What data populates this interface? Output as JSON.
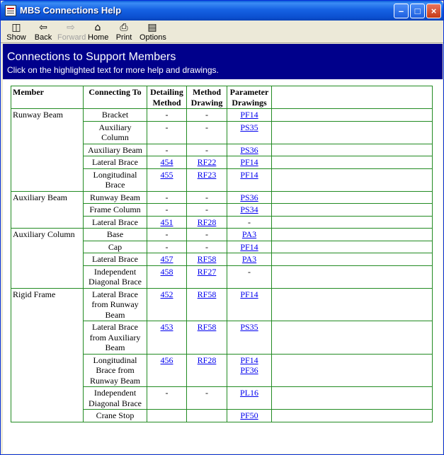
{
  "window": {
    "title": "MBS Connections Help"
  },
  "toolbar": {
    "show": "Show",
    "back": "Back",
    "forward": "Forward",
    "home": "Home",
    "print": "Print",
    "options": "Options"
  },
  "banner": {
    "title": "Connections to Support Members",
    "subtitle": "Click on the highlighted text for more help and drawings."
  },
  "table": {
    "headers": {
      "member": "Member",
      "connecting_to": "Connecting To",
      "detailing_method": "Detailing Method",
      "method_drawing": "Method Drawing",
      "parameter_drawings": "Parameter Drawings"
    },
    "groups": [
      {
        "member": "Runway Beam",
        "rows": [
          {
            "to": "Bracket",
            "detail": "-",
            "method": "-",
            "params": [
              "PF14"
            ]
          },
          {
            "to": "Auxiliary Column",
            "detail": "-",
            "method": "-",
            "params": [
              "PS35"
            ]
          },
          {
            "to": "Auxiliary Beam",
            "detail": "-",
            "method": "-",
            "params": [
              "PS36"
            ]
          },
          {
            "to": "Lateral Brace",
            "detail": "454",
            "method": "RF22",
            "params": [
              "PF14"
            ]
          },
          {
            "to": "Longitudinal Brace",
            "detail": "455",
            "method": "RF23",
            "params": [
              "PF14"
            ]
          }
        ]
      },
      {
        "member": "Auxiliary Beam",
        "rows": [
          {
            "to": "Runway Beam",
            "detail": "-",
            "method": "-",
            "params": [
              "PS36"
            ]
          },
          {
            "to": "Frame Column",
            "detail": "-",
            "method": "-",
            "params": [
              "PS34"
            ]
          },
          {
            "to": "Lateral Brace",
            "detail": "451",
            "method": "RF28",
            "params": [
              "-"
            ]
          }
        ]
      },
      {
        "member": "Auxiliary Column",
        "rows": [
          {
            "to": "Base",
            "detail": "-",
            "method": "-",
            "params": [
              "PA3"
            ]
          },
          {
            "to": "Cap",
            "detail": "-",
            "method": "-",
            "params": [
              "PF14"
            ]
          },
          {
            "to": "Lateral Brace",
            "detail": "457",
            "method": "RF58",
            "params": [
              "PA3"
            ]
          },
          {
            "to": "Independent Diagonal Brace",
            "detail": "458",
            "method": "RF27",
            "params": [
              "-"
            ]
          }
        ]
      },
      {
        "member": "Rigid Frame",
        "rows": [
          {
            "to": "Lateral Brace from Runway Beam",
            "detail": "452",
            "method": "RF58",
            "params": [
              "PF14"
            ]
          },
          {
            "to": "Lateral Brace from Auxiliary Beam",
            "detail": "453",
            "method": "RF58",
            "params": [
              "PS35"
            ]
          },
          {
            "to": "Longitudinal Brace from Runway Beam",
            "detail": "456",
            "method": "RF28",
            "params": [
              "PF14",
              "PF36"
            ]
          },
          {
            "to": "Independent Diagonal Brace",
            "detail": "-",
            "method": "-",
            "params": [
              "PL16"
            ]
          },
          {
            "to": "Crane Stop",
            "detail": "",
            "method": "",
            "params": [
              "PF50"
            ]
          }
        ]
      }
    ]
  }
}
